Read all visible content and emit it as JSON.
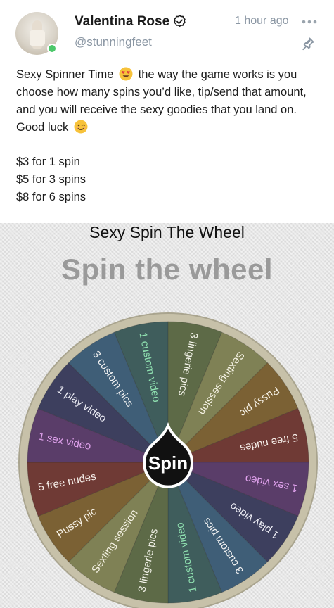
{
  "post": {
    "display_name": "Valentina Rose",
    "handle": "@stunningfeet",
    "timestamp": "1 hour ago",
    "text_part1": "Sexy Spinner Time",
    "text_part2": "the way the game works is you choose how many spins you’d like, tip/send that amount, and you will receive the sexy goodies that you land on. Good luck",
    "prices": [
      "$3 for 1 spin",
      "$5 for 3 spins",
      "$8 for 6 spins"
    ],
    "icons": {
      "verified": "verified-badge-icon",
      "more": "more-dots-icon",
      "pin": "pin-icon",
      "emoji1": "heart-eyes-emoji",
      "emoji2": "wink-emoji",
      "online": "online-status-dot"
    },
    "colors": {
      "online": "#4cc86a",
      "muted_text": "#8a96a3"
    }
  },
  "wheel": {
    "caption": "Sexy Spin The Wheel",
    "headline": "Spin the wheel",
    "button_label": "Spin",
    "segments": [
      {
        "label": "1 custom video",
        "color": "#3f5d5c",
        "text_color": "#8fe0b0"
      },
      {
        "label": "3 lingerie pics",
        "color": "#5d6a47",
        "text_color": "#f2f2e8"
      },
      {
        "label": "Sexting session",
        "color": "#7f8155",
        "text_color": "#f6f3e5"
      },
      {
        "label": "Pussy pic",
        "color": "#7b6134",
        "text_color": "#f6f1e6"
      },
      {
        "label": "5 free nudes",
        "color": "#6f3a35",
        "text_color": "#f7efea"
      },
      {
        "label": "1 sex video",
        "color": "#5a3d69",
        "text_color": "#e1a3ee"
      },
      {
        "label": "1 play video",
        "color": "#3d3f5e",
        "text_color": "#ececf4"
      },
      {
        "label": "3 custom pics",
        "color": "#3f5e77",
        "text_color": "#f2f2f2"
      },
      {
        "label": "1 custom video",
        "color": "#3f5d5c",
        "text_color": "#8fe0b0"
      },
      {
        "label": "3 lingerie pics",
        "color": "#5d6a47",
        "text_color": "#f2f2e8"
      },
      {
        "label": "Sexting session",
        "color": "#7f8155",
        "text_color": "#f6f3e5"
      },
      {
        "label": "Pussy pic",
        "color": "#7b6134",
        "text_color": "#f6f1e6"
      },
      {
        "label": "5 free nudes",
        "color": "#6f3a35",
        "text_color": "#f7efea"
      },
      {
        "label": "1 sex video",
        "color": "#5a3d69",
        "text_color": "#e1a3ee"
      },
      {
        "label": "1 play video",
        "color": "#3d3f5e",
        "text_color": "#ececf4"
      },
      {
        "label": "3 custom pics",
        "color": "#3f5e77",
        "text_color": "#f2f2f2"
      }
    ],
    "colors": {
      "rim": "#c7c1a9",
      "hub": "#111111",
      "hub_text": "#ffffff"
    }
  }
}
